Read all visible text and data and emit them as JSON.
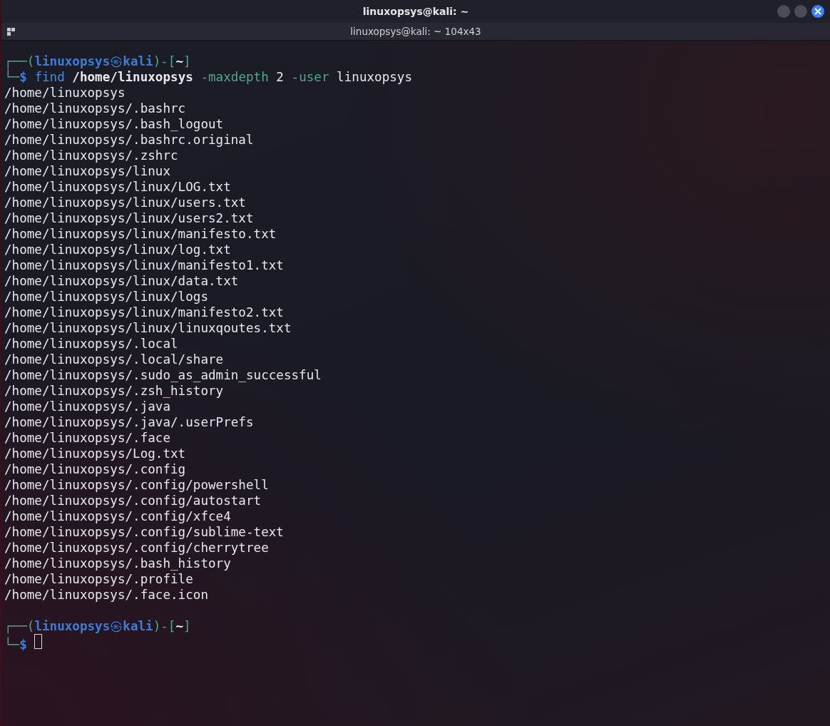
{
  "window": {
    "title": "linuxopsys@kali: ~"
  },
  "tab_bar": {
    "title": "linuxopsys@kali: ~ 104x43"
  },
  "terminal": {
    "blocks": [
      {
        "prompt": {
          "corner_top": "┌──(",
          "user": "linuxopsys",
          "separator": "㉿",
          "host": "kali",
          "middle": ")-[",
          "dir": "~",
          "end": "]",
          "corner_bottom": "└─",
          "symbol": "$"
        },
        "command": [
          {
            "kind": "command",
            "text": "find"
          },
          {
            "kind": "path",
            "text": "/home/linuxopsys"
          },
          {
            "kind": "option",
            "text": "-maxdepth"
          },
          {
            "kind": "arg",
            "text": "2"
          },
          {
            "kind": "option",
            "text": "-user"
          },
          {
            "kind": "arg",
            "text": "linuxopsys"
          }
        ],
        "output": [
          "/home/linuxopsys",
          "/home/linuxopsys/.bashrc",
          "/home/linuxopsys/.bash_logout",
          "/home/linuxopsys/.bashrc.original",
          "/home/linuxopsys/.zshrc",
          "/home/linuxopsys/linux",
          "/home/linuxopsys/linux/LOG.txt",
          "/home/linuxopsys/linux/users.txt",
          "/home/linuxopsys/linux/users2.txt",
          "/home/linuxopsys/linux/manifesto.txt",
          "/home/linuxopsys/linux/log.txt",
          "/home/linuxopsys/linux/manifesto1.txt",
          "/home/linuxopsys/linux/data.txt",
          "/home/linuxopsys/linux/logs",
          "/home/linuxopsys/linux/manifesto2.txt",
          "/home/linuxopsys/linux/linuxqoutes.txt",
          "/home/linuxopsys/.local",
          "/home/linuxopsys/.local/share",
          "/home/linuxopsys/.sudo_as_admin_successful",
          "/home/linuxopsys/.zsh_history",
          "/home/linuxopsys/.java",
          "/home/linuxopsys/.java/.userPrefs",
          "/home/linuxopsys/.face",
          "/home/linuxopsys/Log.txt",
          "/home/linuxopsys/.config",
          "/home/linuxopsys/.config/powershell",
          "/home/linuxopsys/.config/autostart",
          "/home/linuxopsys/.config/xfce4",
          "/home/linuxopsys/.config/sublime-text",
          "/home/linuxopsys/.config/cherrytree",
          "/home/linuxopsys/.bash_history",
          "/home/linuxopsys/.profile",
          "/home/linuxopsys/.face.icon"
        ]
      },
      {
        "prompt": {
          "corner_top": "┌──(",
          "user": "linuxopsys",
          "separator": "㉿",
          "host": "kali",
          "middle": ")-[",
          "dir": "~",
          "end": "]",
          "corner_bottom": "└─",
          "symbol": "$"
        },
        "cursor": true
      }
    ]
  }
}
